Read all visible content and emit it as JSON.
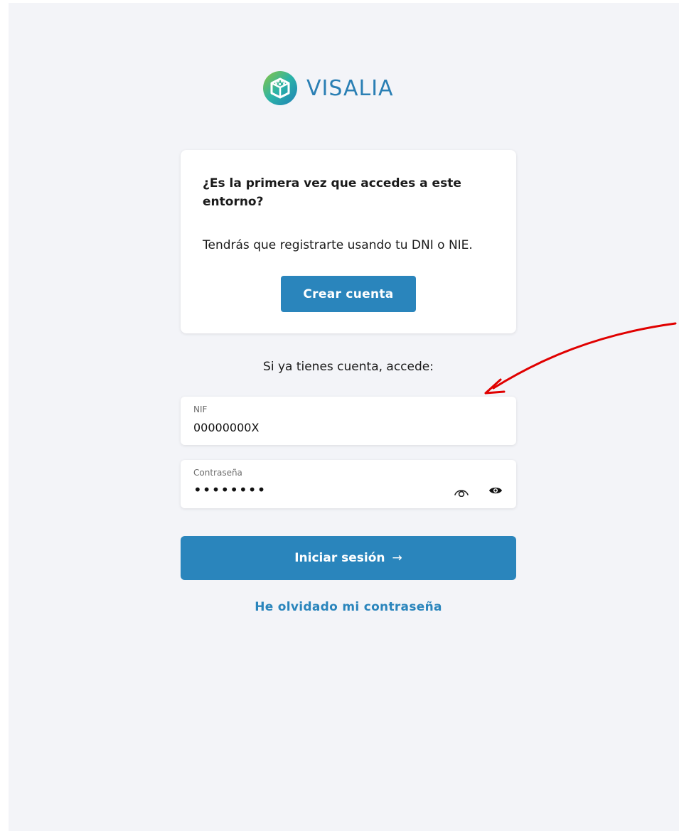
{
  "brand": {
    "name": "VISALIA"
  },
  "register_card": {
    "title": "¿Es la primera vez que accedes a este entorno?",
    "text": "Tendrás que registrarte usando tu DNI o NIE.",
    "create_button": "Crear cuenta"
  },
  "login": {
    "subtitle": "Si ya tienes cuenta, accede:",
    "nif": {
      "label": "NIF",
      "value": "00000000X"
    },
    "password": {
      "label": "Contraseña",
      "value": "••••••••"
    },
    "submit_label": "Iniciar sesión",
    "submit_arrow": "→",
    "forgot_link": "He olvidado mi contraseña"
  },
  "icons": {
    "logo": "visalia-cube-logo-icon",
    "show_password": "eye-outline-icon",
    "toggle_password": "eye-solid-icon",
    "annotation": "red-arrow-annotation"
  },
  "colors": {
    "background": "#f3f4f8",
    "primary": "#2a85bc",
    "annotation": "#e00000"
  }
}
